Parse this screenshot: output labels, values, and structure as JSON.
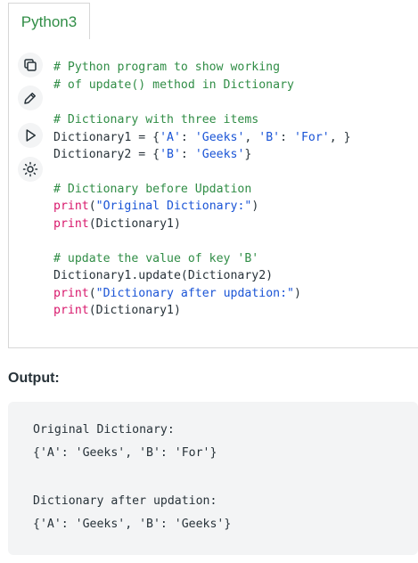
{
  "tab": {
    "label": "Python3"
  },
  "toolbar": {
    "copy_icon": "copy-icon",
    "edit_icon": "pencil-icon",
    "run_icon": "play-icon",
    "theme_icon": "sun-icon"
  },
  "code": {
    "lines": [
      "# Python program to show working",
      "# of update() method in Dictionary",
      "",
      "# Dictionary with three items",
      "Dictionary1 = {'A': 'Geeks', 'B': 'For', }",
      "Dictionary2 = {'B': 'Geeks'}",
      "",
      "# Dictionary before Updation",
      "print(\"Original Dictionary:\")",
      "print(Dictionary1)",
      "",
      "# update the value of key 'B'",
      "Dictionary1.update(Dictionary2)",
      "print(\"Dictionary after updation:\")",
      "print(Dictionary1)"
    ]
  },
  "output": {
    "label": "Output:",
    "lines": [
      "Original Dictionary:",
      "{'A': 'Geeks', 'B': 'For'}",
      "",
      "Dictionary after updation:",
      "{'A': 'Geeks', 'B': 'Geeks'}"
    ]
  },
  "colors": {
    "comment": "#308d46",
    "string": "#1a54d6",
    "keyword": "#d8176b",
    "text": "#273239",
    "output_bg": "#f3f4f5"
  }
}
